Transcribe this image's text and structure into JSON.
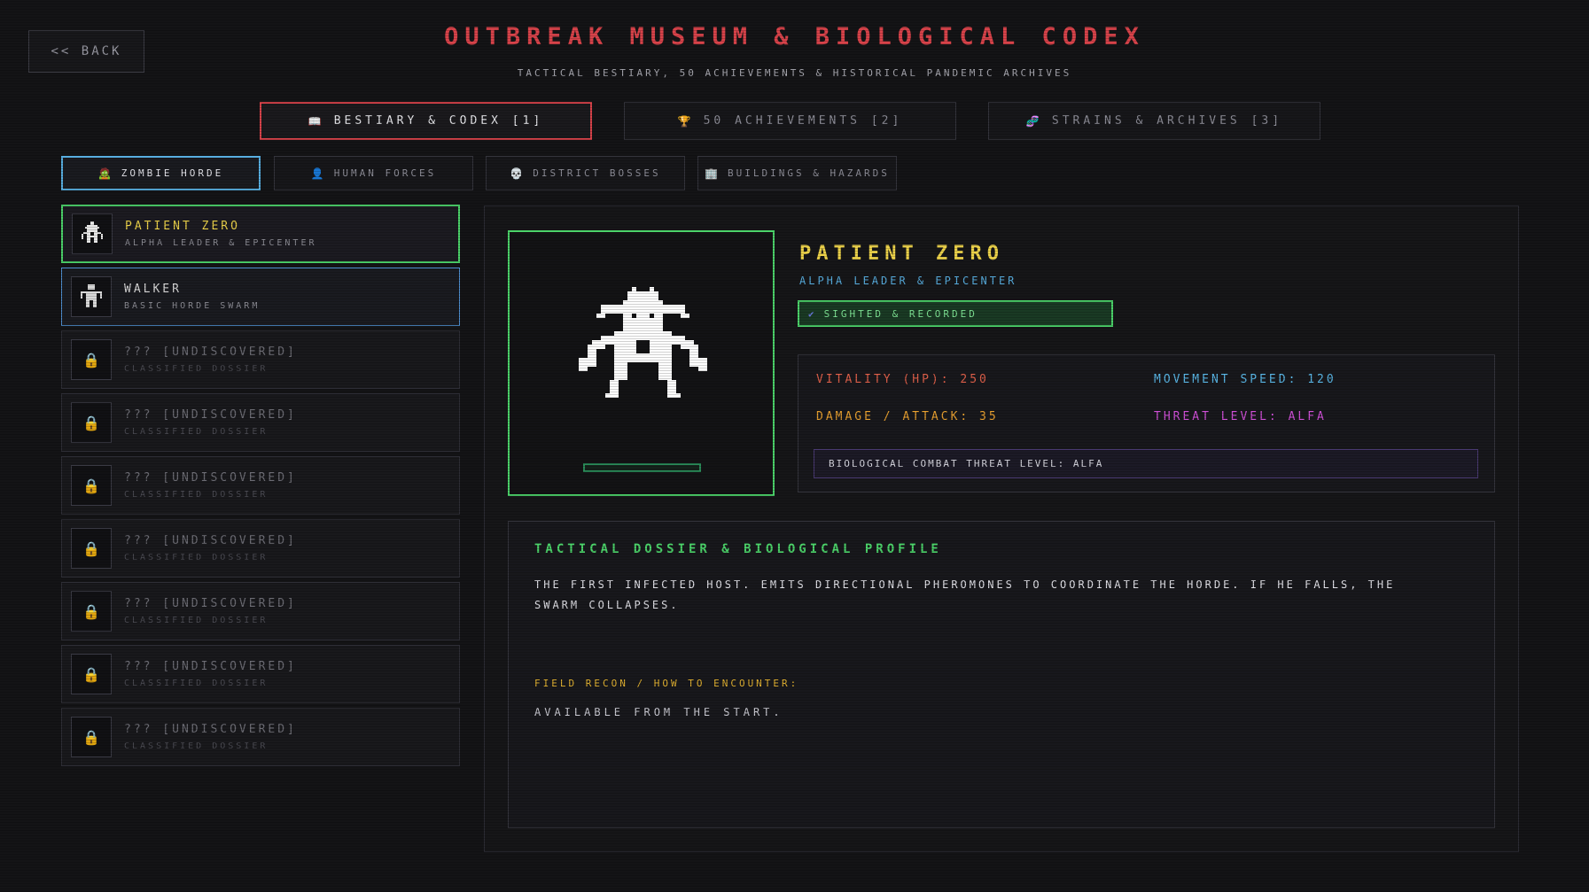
{
  "back_label": "<< BACK",
  "title": "OUTBREAK MUSEUM & BIOLOGICAL CODEX",
  "subtitle": "TACTICAL BESTIARY, 50 ACHIEVEMENTS & HISTORICAL PANDEMIC ARCHIVES",
  "tabs": [
    {
      "icon": "📖",
      "label": "BESTIARY & CODEX [1]",
      "active": true
    },
    {
      "icon": "🏆",
      "label": "50 ACHIEVEMENTS [2]",
      "active": false
    },
    {
      "icon": "🧬",
      "label": "STRAINS & ARCHIVES [3]",
      "active": false
    }
  ],
  "subtabs": [
    {
      "icon": "🧟",
      "label": "ZOMBIE HORDE",
      "active": true
    },
    {
      "icon": "👤",
      "label": "HUMAN FORCES",
      "active": false
    },
    {
      "icon": "💀",
      "label": "DISTRICT BOSSES",
      "active": false
    },
    {
      "icon": "🏢",
      "label": "BUILDINGS & HAZARDS",
      "active": false
    }
  ],
  "entries": [
    {
      "name": "PATIENT ZERO",
      "sub": "ALPHA LEADER & EPICENTER",
      "state": "selected"
    },
    {
      "name": "WALKER",
      "sub": "BASIC HORDE SWARM",
      "state": "found"
    },
    {
      "name": "??? [UNDISCOVERED]",
      "sub": "CLASSIFIED DOSSIER",
      "state": "locked"
    },
    {
      "name": "??? [UNDISCOVERED]",
      "sub": "CLASSIFIED DOSSIER",
      "state": "locked"
    },
    {
      "name": "??? [UNDISCOVERED]",
      "sub": "CLASSIFIED DOSSIER",
      "state": "locked"
    },
    {
      "name": "??? [UNDISCOVERED]",
      "sub": "CLASSIFIED DOSSIER",
      "state": "locked"
    },
    {
      "name": "??? [UNDISCOVERED]",
      "sub": "CLASSIFIED DOSSIER",
      "state": "locked"
    },
    {
      "name": "??? [UNDISCOVERED]",
      "sub": "CLASSIFIED DOSSIER",
      "state": "locked"
    },
    {
      "name": "??? [UNDISCOVERED]",
      "sub": "CLASSIFIED DOSSIER",
      "state": "locked"
    }
  ],
  "lock_icon": "🔒",
  "detail": {
    "name": "PATIENT ZERO",
    "role": "ALPHA LEADER & EPICENTER",
    "status": "SIGHTED & RECORDED",
    "status_icon": "✔",
    "stats": {
      "vitality": "VITALITY (HP): 250",
      "speed": "MOVEMENT SPEED: 120",
      "damage": "DAMAGE / ATTACK: 35",
      "threat": "THREAT LEVEL: ALFA"
    },
    "threat_bar": "BIOLOGICAL COMBAT THREAT LEVEL: ALFA",
    "dossier_title": "TACTICAL DOSSIER & BIOLOGICAL PROFILE",
    "dossier_text": "THE FIRST INFECTED HOST. EMITS DIRECTIONAL PHEROMONES TO COORDINATE THE HORDE. IF HE FALLS, THE SWARM COLLAPSES.",
    "recon_label": "FIELD RECON / HOW TO ENCOUNTER:",
    "recon_text": "AVAILABLE FROM THE START."
  },
  "colors": {
    "title_red": "#d8434a",
    "accent_green": "#4cd36a",
    "accent_blue": "#58aee0",
    "accent_yellow": "#ecd24a",
    "stat_red": "#e0604a",
    "stat_cyan": "#5ab8e8",
    "stat_orange": "#e8a030",
    "stat_magenta": "#d050d8"
  }
}
